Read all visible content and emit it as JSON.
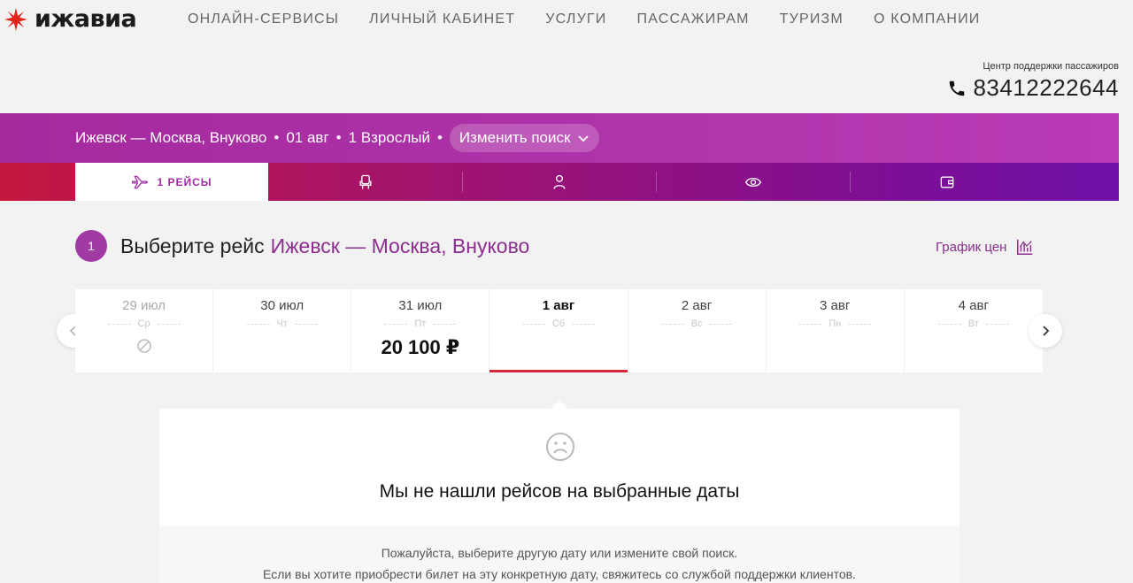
{
  "header": {
    "logo_text": "ижавиа",
    "brand_color": "#e2231a",
    "menu": [
      {
        "label": "ОНЛАЙН-СЕРВИСЫ"
      },
      {
        "label": "ЛИЧНЫЙ КАБИНЕТ"
      },
      {
        "label": "УСЛУГИ"
      },
      {
        "label": "ПАССАЖИРАМ"
      },
      {
        "label": "ТУРИЗМ"
      },
      {
        "label": "О КОМПАНИИ"
      }
    ]
  },
  "support": {
    "label": "Центр поддержки пассажиров",
    "phone": "83412222644",
    "icon": "phone-icon"
  },
  "search_summary": {
    "route": "Ижевск — Москва, Внуково",
    "date": "01 авг",
    "passengers": "1 Взрослый",
    "separator": "•",
    "change_label": "Изменить поиск",
    "accent_color": "#b03aac"
  },
  "steps": {
    "active_label": "1 РЕЙСЫ",
    "icons": [
      "plane-icon",
      "seat-icon",
      "person-icon",
      "eye-icon",
      "wallet-icon"
    ]
  },
  "selection": {
    "step_number": "1",
    "heading": "Выберите рейс",
    "route": "Ижевск — Москва, Внуково",
    "price_graph_label": "График цен"
  },
  "dates": [
    {
      "date": "29 июл",
      "weekday": "Ср",
      "status": "unavailable"
    },
    {
      "date": "30 июл",
      "weekday": "Чт",
      "price": ""
    },
    {
      "date": "31 июл",
      "weekday": "Пт",
      "price": "20 100 ₽"
    },
    {
      "date": "1 авг",
      "weekday": "Сб",
      "price": "",
      "selected": true
    },
    {
      "date": "2 авг",
      "weekday": "Вс",
      "price": ""
    },
    {
      "date": "3 авг",
      "weekday": "Пн",
      "price": ""
    },
    {
      "date": "4 авг",
      "weekday": "Вт",
      "price": ""
    }
  ],
  "no_flights": {
    "title": "Мы не нашли рейсов на выбранные даты",
    "message_line1": "Пожалуйста, выберите другую дату или измените свой поиск.",
    "message_line2": "Если вы хотите приобрести билет на эту конкретную дату, свяжитесь со службой поддержки клиентов.",
    "icon": "sad-face-icon"
  }
}
